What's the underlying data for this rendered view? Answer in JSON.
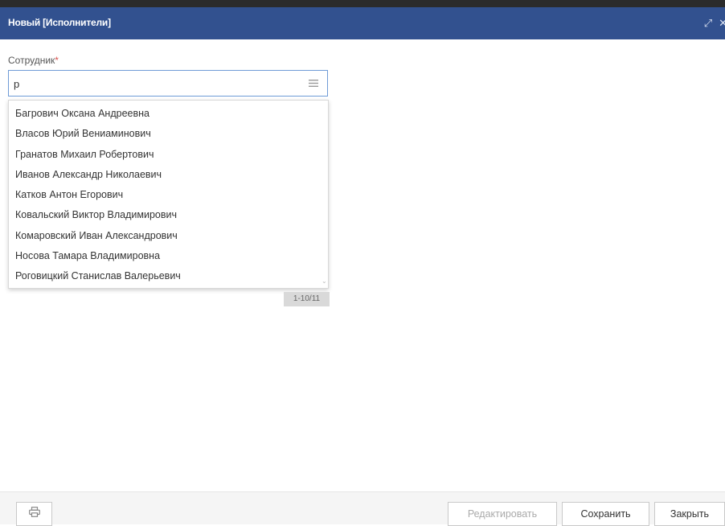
{
  "window": {
    "title": "Новый [Исполнители]",
    "icons": [
      "expand-icon",
      "close-icon"
    ]
  },
  "form": {
    "employee_label": "Сотрудник",
    "required_mark": "*",
    "employee_value": "р",
    "list_icon": "list-icon"
  },
  "dropdown": {
    "items": [
      "Багрович Оксана Андреевна",
      "Власов Юрий Вениаминович",
      "Гранатов Михаил Робертович",
      "Иванов Александр Николаевич",
      "Катков Антон Егорович",
      "Ковальский Виктор Владимирович",
      "Комаровский Иван Александрович",
      "Носова Тамара Владимировна",
      "Роговицкий Станислав Валерьевич"
    ],
    "pager": "1-10/11"
  },
  "footer": {
    "print_icon": "printer-icon",
    "edit_label": "Редактировать",
    "save_label": "Сохранить",
    "close_label": "Закрыть"
  },
  "colors": {
    "titlebar": "#32518f",
    "input_border": "#6f9bd6",
    "required": "#d9534f"
  }
}
